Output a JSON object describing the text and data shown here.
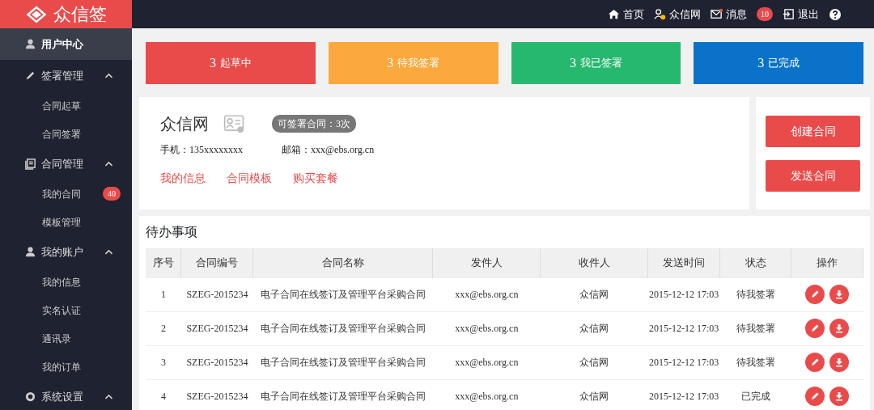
{
  "brand": {
    "name": "众信签"
  },
  "topbar": {
    "links": [
      {
        "kind": "home",
        "label": "首页"
      },
      {
        "kind": "user",
        "label": "众信网"
      },
      {
        "kind": "mail",
        "label": "消息",
        "badge": "10"
      },
      {
        "kind": "logout",
        "label": "退出"
      },
      {
        "kind": "help"
      }
    ]
  },
  "sidebar": {
    "items": [
      {
        "kind": "section",
        "label": "用户中心",
        "selected": true
      },
      {
        "kind": "section",
        "label": "签署管理",
        "selected": false,
        "expanded": true,
        "children": [
          {
            "label": "合同起草"
          },
          {
            "label": "合同签署"
          }
        ]
      },
      {
        "kind": "section",
        "label": "合同管理",
        "selected": false,
        "expanded": true,
        "children": [
          {
            "label": "我的合同",
            "badge": "40"
          },
          {
            "label": "模板管理"
          }
        ]
      },
      {
        "kind": "section",
        "label": "我的账户",
        "selected": false,
        "expanded": true,
        "children": [
          {
            "label": "我的信息"
          },
          {
            "label": "实名认证"
          },
          {
            "label": "通讯录"
          },
          {
            "label": "我的订单"
          }
        ]
      },
      {
        "kind": "section",
        "label": "系统设置",
        "selected": false,
        "expanded": true
      }
    ]
  },
  "stats": [
    {
      "count": "3",
      "label": "起草中",
      "color": "#e94b4b"
    },
    {
      "count": "3",
      "label": "待我签署",
      "color": "#fba83c"
    },
    {
      "count": "3",
      "label": "我已签署",
      "color": "#27b86f"
    },
    {
      "count": "3",
      "label": "已完成",
      "color": "#0a73c9"
    }
  ],
  "profile": {
    "name": "众信网",
    "quota": "可签署合同：3次",
    "phone": "手机：135xxxxxxxx",
    "email": "邮箱：xxx@ebs.org.cn",
    "links": [
      "我的信息",
      "合同模板",
      "购买套餐"
    ]
  },
  "actions": [
    "创建合同",
    "发送合同"
  ],
  "todo": {
    "title": "待办事项",
    "table": {
      "columns": [
        "序号",
        "合同编号",
        "合同名称",
        "发件人",
        "收件人",
        "发送时间",
        "状态",
        "操作"
      ],
      "rows": [
        [
          "1",
          "SZEG-2015234",
          "电子合同在线签订及管理平台采购合同",
          "xxx@ebs.org.cn",
          "众信网",
          "2015-12-12 17:03",
          "待我签署"
        ],
        [
          "2",
          "SZEG-2015234",
          "电子合同在线签订及管理平台采购合同",
          "xxx@ebs.org.cn",
          "众信网",
          "2015-12-12 17:03",
          "待我签署"
        ],
        [
          "3",
          "SZEG-2015234",
          "电子合同在线签订及管理平台采购合同",
          "xxx@ebs.org.cn",
          "众信网",
          "2015-12-12 17:03",
          "待我签署"
        ],
        [
          "4",
          "SZEG-2015234",
          "电子合同在线签订及管理平台采购合同",
          "xxx@ebs.org.cn",
          "众信网",
          "2015-12-12 17:03",
          "已完成"
        ]
      ]
    }
  }
}
